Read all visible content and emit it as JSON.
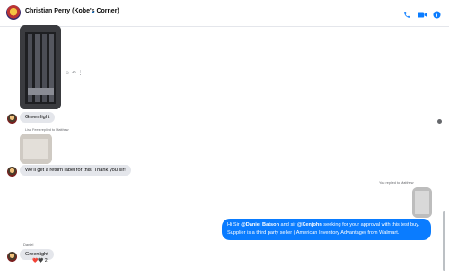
{
  "header": {
    "title": "Christian Perry (Kobe's Corner)",
    "icons": [
      "phone-icon",
      "video-icon",
      "info-icon"
    ],
    "window": {
      "minimize": "—",
      "maximize": "☐",
      "close": "✕"
    }
  },
  "messages": {
    "m1": {
      "text": "Green light",
      "reactions_menu": "☺ ↶ ⋮"
    },
    "reply1": {
      "note": "Lisa Fees replied to Matthew"
    },
    "m2": {
      "text": "We'll get a return label for this. Thank you sir!"
    },
    "reply2": {
      "note": "You replied to Matthew"
    },
    "out": {
      "prefix": "Hi Sir ",
      "mention1": "@Daniel Batson",
      "mid": " and sir ",
      "mention2": "@Kenjohn",
      "suffix": " seeking for your approval with this test buy. Supplier is a third party seller ( American Inventory Advantage) from Walmart."
    },
    "sender_name": "Daniel",
    "m3": {
      "text": "Greenlight",
      "reactions": "❤️🖤 2"
    }
  },
  "colors": {
    "accent": "#0a7cff",
    "bubble_in": "#e4e6eb"
  }
}
